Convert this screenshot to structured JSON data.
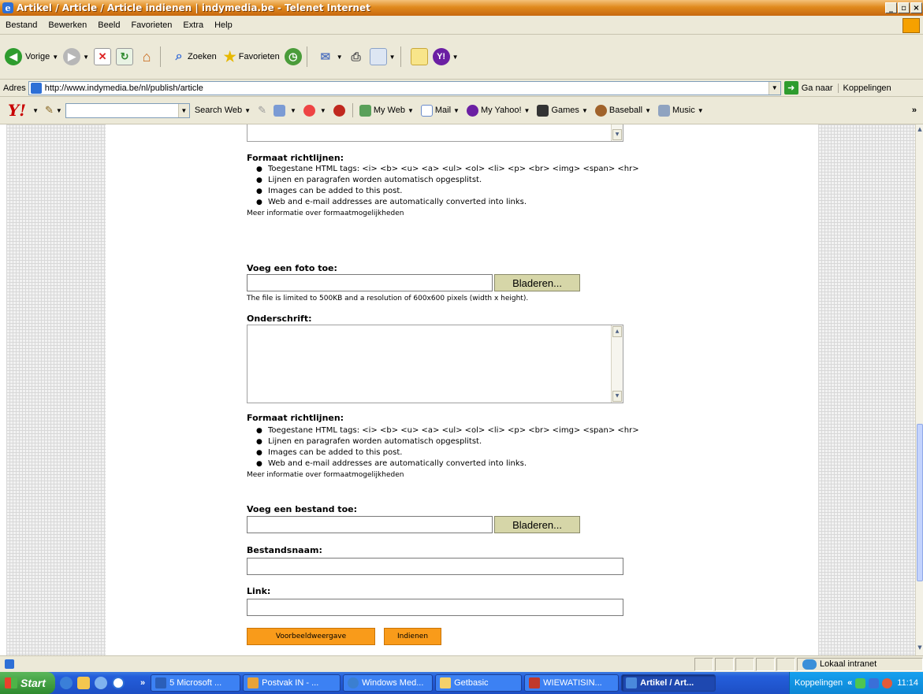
{
  "window": {
    "title": "Artikel / Article / Article indienen | indymedia.be - Telenet Internet",
    "min_label": "_",
    "max_label": "▫",
    "close_label": "×"
  },
  "menu": [
    "Bestand",
    "Bewerken",
    "Beeld",
    "Favorieten",
    "Extra",
    "Help"
  ],
  "toolbar": {
    "back_label": "Vorige",
    "search_label": "Zoeken",
    "favorites_label": "Favorieten"
  },
  "address": {
    "label": "Adres",
    "url": "http://www.indymedia.be/nl/publish/article",
    "go_label": "Ga naar",
    "links_label": "Koppelingen"
  },
  "yahoo": {
    "logo": "Y!",
    "search_web": "Search Web",
    "my_web": "My Web",
    "mail": "Mail",
    "my_yahoo": "My Yahoo!",
    "games": "Games",
    "baseball": "Baseball",
    "music": "Music",
    "more": "»"
  },
  "form": {
    "format_heading": "Formaat richtlijnen:",
    "guidelines": [
      "Toegestane HTML tags: <i> <b> <u> <a> <ul> <ol> <li> <p> <br> <img> <span> <hr>",
      "Lijnen en paragrafen worden automatisch opgesplitst.",
      "Images can be added to this post.",
      "Web and e-mail addresses are automatically converted into links."
    ],
    "more_info": "Meer informatie over formaatmogelijkheden",
    "photo_heading": "Voeg een foto toe:",
    "browse_label": "Bladeren...",
    "photo_note": "The file is limited to 500KB and a resolution of 600x600 pixels (width x height).",
    "caption_heading": "Onderschrift:",
    "file_heading": "Voeg een bestand toe:",
    "filename_heading": "Bestandsnaam:",
    "link_heading": "Link:",
    "preview_button": "Voorbeeldweergave",
    "submit_button": "Indienen"
  },
  "status": {
    "zone": "Lokaal intranet"
  },
  "taskbar": {
    "start": "Start",
    "more": "»",
    "tasks": [
      {
        "label": "5 Microsoft ...",
        "color": "#2b5fb9",
        "active": false
      },
      {
        "label": "Postvak IN - ...",
        "color": "#e8a33a",
        "active": false
      },
      {
        "label": "Windows Med...",
        "color": "#3b7fd0",
        "active": false
      },
      {
        "label": "Getbasic",
        "color": "#f4d06a",
        "active": false
      },
      {
        "label": "WIEWATISIN...",
        "color": "#c0392b",
        "active": false
      },
      {
        "label": "Artikel / Art...",
        "color": "#4a89dc",
        "active": true
      }
    ],
    "links": "Koppelingen",
    "tray_more": "«",
    "clock": "11:14"
  }
}
